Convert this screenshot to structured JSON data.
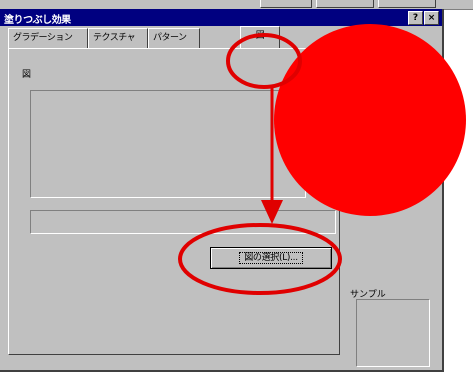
{
  "window": {
    "title": "塗りつぶし効果",
    "help_button": "?",
    "close_button": "×"
  },
  "tabs": [
    {
      "label": "グラデーション"
    },
    {
      "label": "テクスチャ"
    },
    {
      "label": "パターン"
    },
    {
      "label": "図"
    }
  ],
  "panel": {
    "picture_label": "図",
    "picture_name_value": "",
    "select_picture_button": "図の選択(L)..."
  },
  "sample": {
    "label": "サンプル"
  },
  "annotation": {
    "highlight_color": "#e00000",
    "circle_fill": "#ff0000"
  }
}
